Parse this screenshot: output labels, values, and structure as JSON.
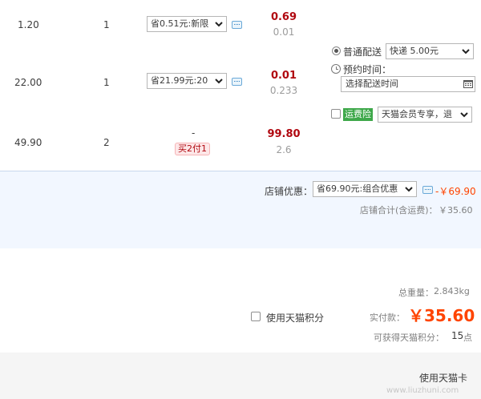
{
  "rows": [
    {
      "unit_price": "1.20",
      "quantity": "1",
      "promo": "省0.51元:新限",
      "subtotal": "0.69",
      "weight": "0.01"
    },
    {
      "unit_price": "22.00",
      "quantity": "1",
      "promo": "省21.99元:20",
      "subtotal": "0.01",
      "weight": "0.233"
    },
    {
      "unit_price": "49.90",
      "quantity": "2",
      "promo": "-",
      "promo_tag": "买2付1",
      "subtotal": "99.80",
      "weight": "2.6"
    }
  ],
  "delivery": {
    "option_label": "普通配送",
    "option_value": "快递 5.00元",
    "time_label": "预约时间：",
    "time_placeholder": "选择配送时间",
    "insurance_badge": "运费险",
    "insurance_value": "天猫会员专享，退"
  },
  "shop": {
    "discount_label": "店铺优惠：",
    "discount_value": "省69.90元:组合优惠",
    "discount_amount": "-￥69.90",
    "total_label": "店铺合计(含运费)：",
    "total_value": "￥35.60"
  },
  "summary": {
    "weight_label": "总重量：",
    "weight_value": "2.843kg",
    "points_checkbox_label": "使用天猫积分",
    "pay_label": "实付款：",
    "pay_value": "￥35.60",
    "points_earn_label": "可获得天猫积分：",
    "points_earn_value": "15",
    "points_unit": "点",
    "bottom_label": "使用天猫卡",
    "watermark": "www.liuzhuni.com"
  },
  "colors": {
    "accent": "#ff4400",
    "price_red": "#b0070f",
    "shop_band": "#f2f7ff",
    "insurance_green": "#3ea84a"
  }
}
